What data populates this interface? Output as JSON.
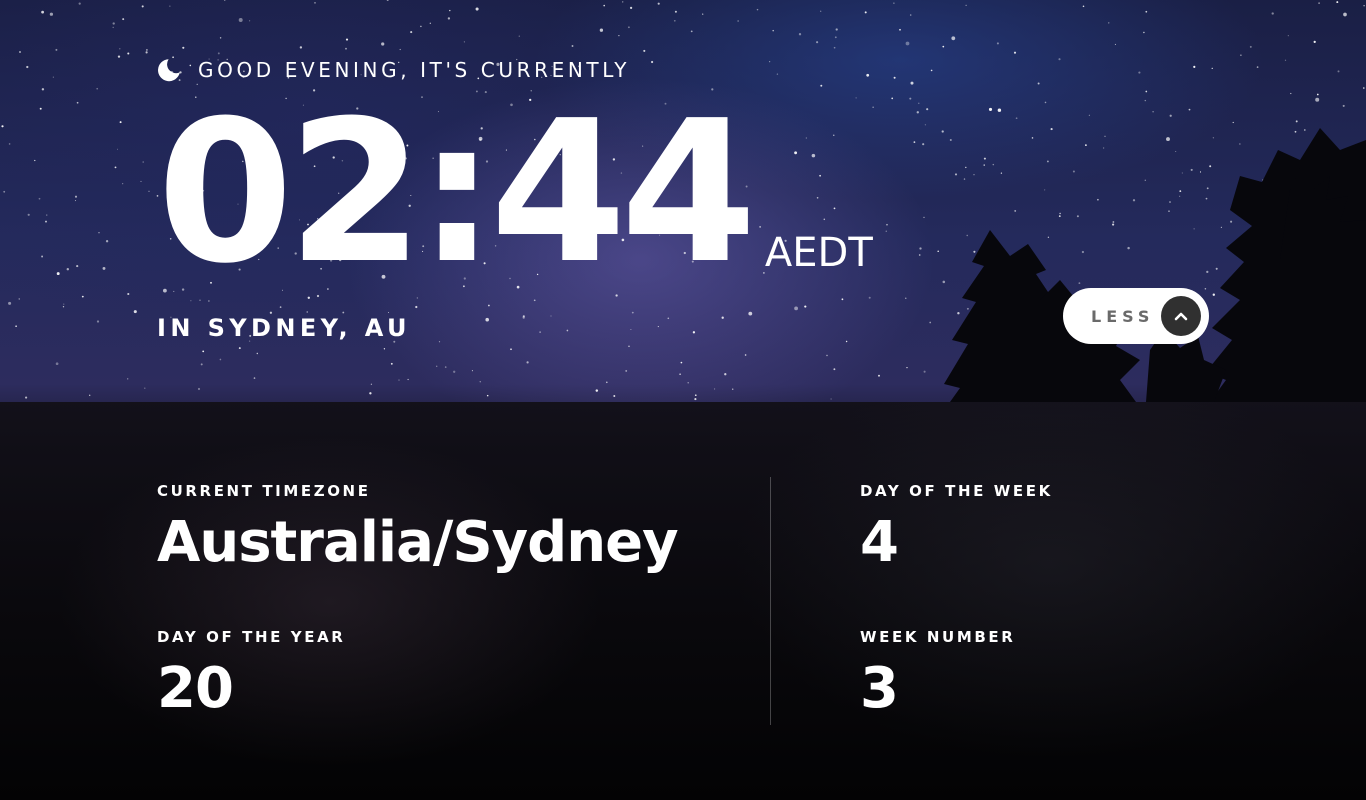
{
  "header": {
    "greeting": "GOOD EVENING, IT'S CURRENTLY",
    "greeting_icon": "moon-icon",
    "time": "02:44",
    "timezone_abbr": "AEDT",
    "location": "IN SYDNEY, AU"
  },
  "toggle": {
    "label": "LESS",
    "icon": "chevron-up-icon"
  },
  "details": {
    "current_timezone": {
      "label": "CURRENT TIMEZONE",
      "value": "Australia/Sydney"
    },
    "day_of_year": {
      "label": "DAY OF THE YEAR",
      "value": "20"
    },
    "day_of_week": {
      "label": "DAY OF THE WEEK",
      "value": "4"
    },
    "week_number": {
      "label": "WEEK NUMBER",
      "value": "3"
    }
  },
  "colors": {
    "text": "#ffffff",
    "button_bg": "#ffffff",
    "button_text": "#6a6a6a",
    "arrow_bg": "#303030"
  }
}
